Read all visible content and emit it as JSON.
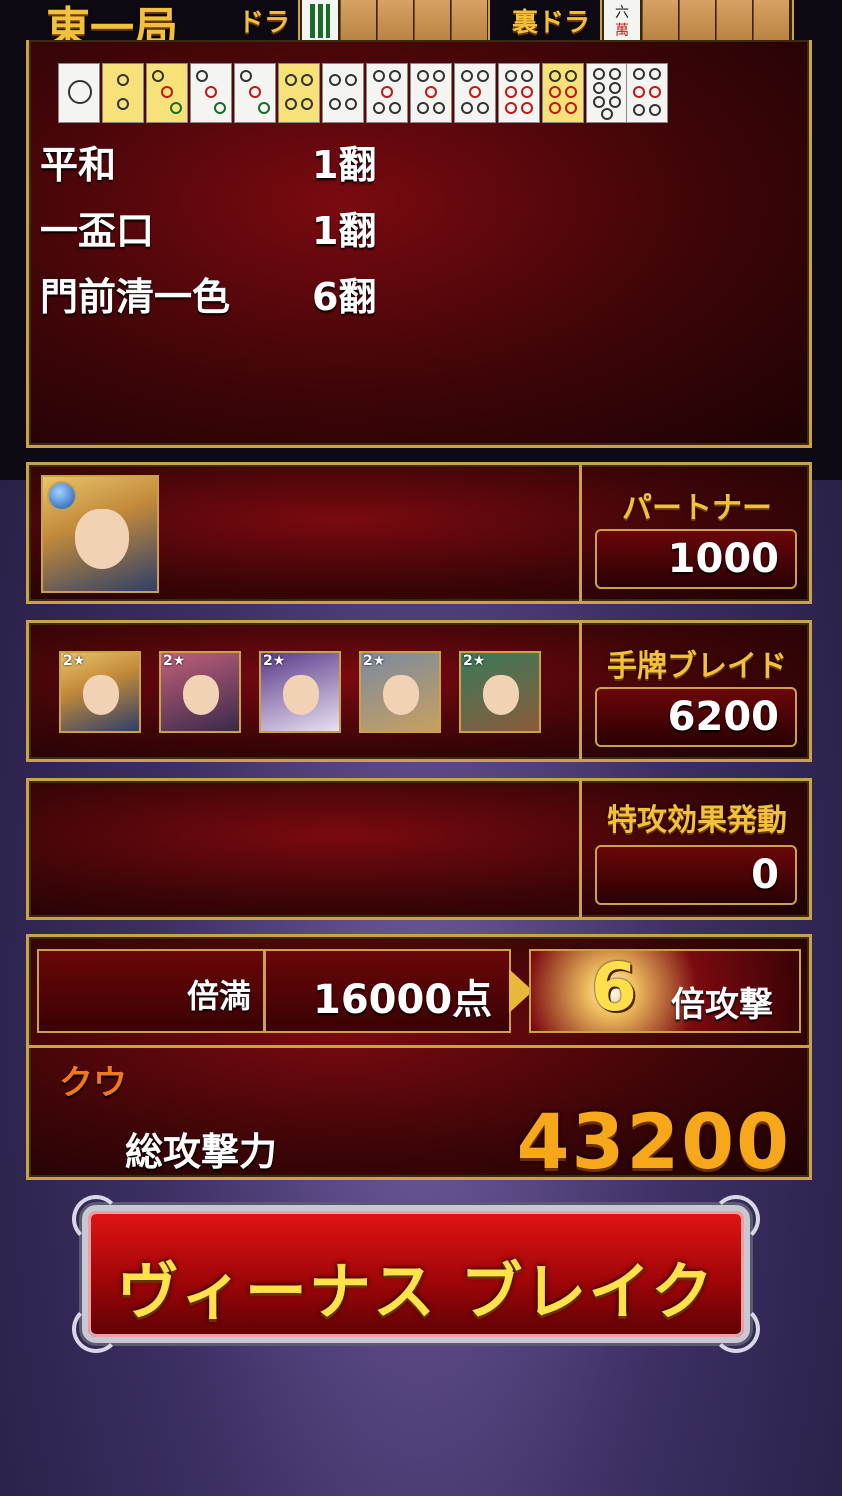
{
  "round": {
    "name": "東一局",
    "dora_label": "ドラ",
    "ura_dora_label": "裏ドラ",
    "dora_tile": "8索",
    "ura_dora_tile": "六萬"
  },
  "hand_tiles": [
    "9pin_circle",
    "2pin",
    "3pin",
    "3pin",
    "3pin",
    "4pin",
    "4pin",
    "5pin",
    "6pin",
    "6pin",
    "7pin",
    "7pin",
    "8pin",
    "8pin"
  ],
  "yaku": [
    {
      "name": "平和",
      "han": "1翻"
    },
    {
      "name": "一盃口",
      "han": "1翻"
    },
    {
      "name": "門前清一色",
      "han": "6翻"
    }
  ],
  "partner": {
    "label": "パートナー",
    "value": "1000"
  },
  "hand_break": {
    "label": "手牌ブレイド",
    "value": "6200",
    "units_star": [
      "2★",
      "2★",
      "2★",
      "2★",
      "2★"
    ]
  },
  "special": {
    "label": "特攻効果発動",
    "value": "0"
  },
  "score": {
    "rank": "倍満",
    "points": "16000点",
    "multiplier": "6",
    "multiplier_label": "倍攻撃"
  },
  "total": {
    "character": "クウ",
    "label": "総攻撃力",
    "value": "43200"
  },
  "button": {
    "label": "ヴィーナス ブレイク"
  },
  "colors": {
    "gold": "#f2c03a",
    "panel_red": "#7a0a10",
    "border_gold": "#c9a24a"
  }
}
